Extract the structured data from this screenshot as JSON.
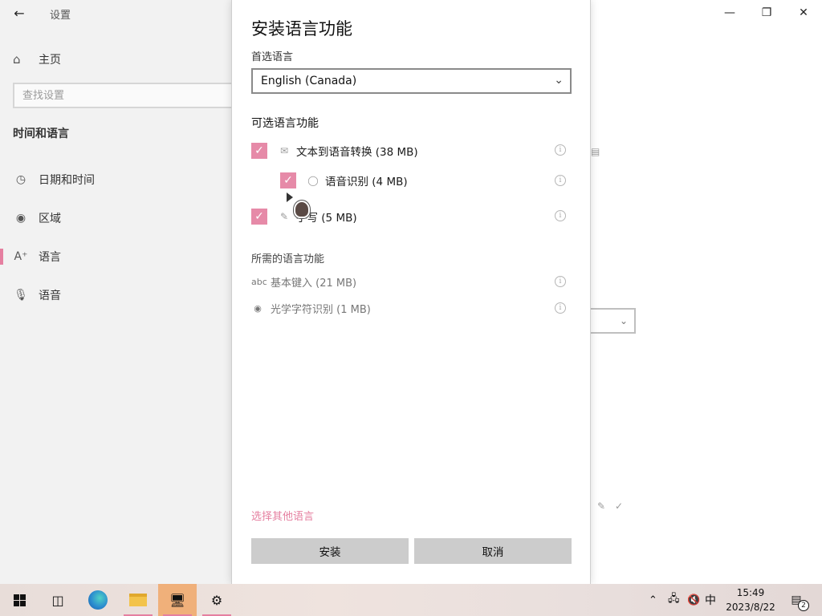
{
  "settings": {
    "app_title": "设置",
    "home_label": "主页",
    "search_placeholder": "查找设置",
    "section_title": "时间和语言",
    "nav": [
      {
        "label": "日期和时间",
        "icon": "calendar-clock-icon"
      },
      {
        "label": "区域",
        "icon": "globe-icon"
      },
      {
        "label": "语言",
        "icon": "language-icon",
        "active": true
      },
      {
        "label": "语音",
        "icon": "microphone-icon"
      }
    ]
  },
  "dialog": {
    "title": "安装语言功能",
    "preferred_label": "首选语言",
    "preferred_value": "English (Canada)",
    "optional_heading": "可选语言功能",
    "optional_features": [
      {
        "label": "文本到语音转换 (38 MB)",
        "checked": true,
        "icon": "text-to-speech-icon"
      },
      {
        "label": "语音识别 (4 MB)",
        "checked": true,
        "icon": "microphone-icon"
      },
      {
        "label": "手写 (5 MB)",
        "checked": true,
        "icon": "handwriting-icon"
      }
    ],
    "required_heading": "所需的语言功能",
    "required_features": [
      {
        "label": "基本键入 (21 MB)",
        "icon": "abc-icon"
      },
      {
        "label": "光学字符识别 (1 MB)",
        "icon": "ocr-icon"
      }
    ],
    "other_link": "选择其他语言",
    "install_label": "安装",
    "cancel_label": "取消"
  },
  "taskbar": {
    "time": "15:49",
    "date": "2023/8/22",
    "ime": "中",
    "notification_count": "2"
  },
  "colors": {
    "accent": "#e68aa8",
    "button_gray": "#cccccc"
  }
}
